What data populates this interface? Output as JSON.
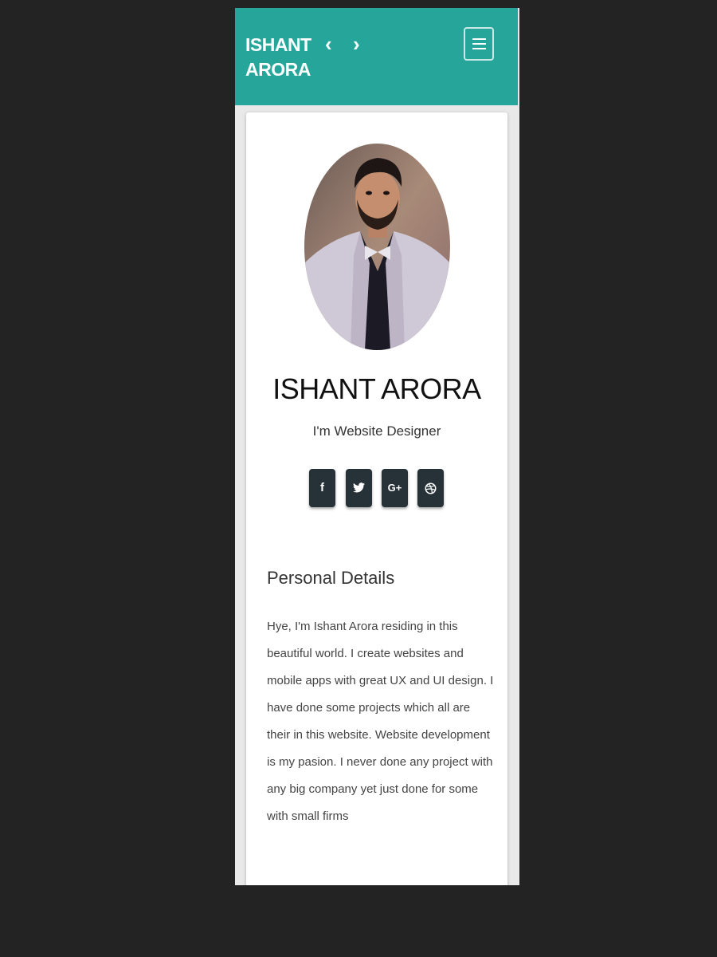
{
  "header": {
    "brand": "ISHANT\nARORA",
    "prev_label": "‹",
    "next_label": "›",
    "menu_icon": "hamburger-icon",
    "bg_color": "#26a69a"
  },
  "profile": {
    "name": "ISHANT ARORA",
    "role": "I'm Website Designer",
    "photo": "profile-photo"
  },
  "social": [
    {
      "icon": "facebook-icon",
      "label": "f"
    },
    {
      "icon": "twitter-icon",
      "label": ""
    },
    {
      "icon": "google-plus-icon",
      "label": "G+"
    },
    {
      "icon": "dribbble-icon",
      "label": ""
    }
  ],
  "details": {
    "title": "Personal Details",
    "bio": "Hye, I'm Ishant Arora residing in this beautiful world. I create websites and mobile apps with great UX and UI design. I have done some projects which all are their in this website. Website development is my pasion. I never done any project with any big company yet just done for some with small firms"
  },
  "colors": {
    "accent": "#26a69a",
    "social_button": "#263238",
    "page_background": "#232323"
  }
}
